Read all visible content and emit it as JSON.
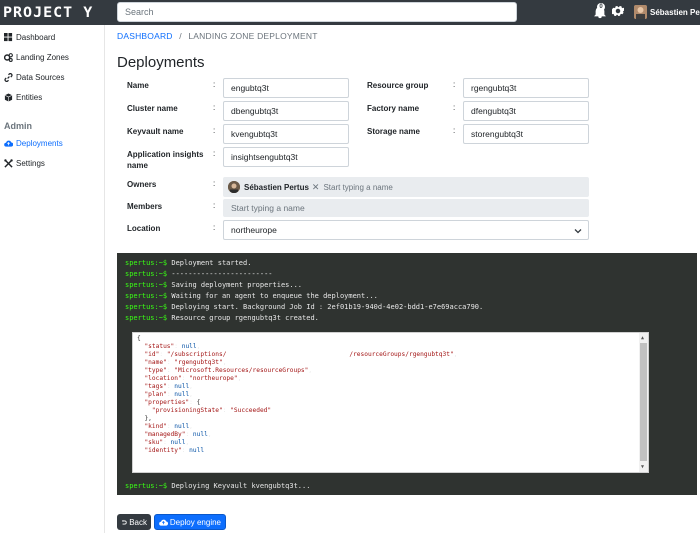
{
  "app": {
    "logo": "PROJECT Y"
  },
  "topbar": {
    "search_placeholder": "Search",
    "notification_count": "0",
    "user_name": "Sébastien Pert"
  },
  "sidebar": {
    "items": [
      {
        "label": "Dashboard",
        "icon": "grid-icon"
      },
      {
        "label": "Landing Zones",
        "icon": "cogs-icon"
      },
      {
        "label": "Data Sources",
        "icon": "link-icon"
      },
      {
        "label": "Entities",
        "icon": "cube-icon"
      }
    ],
    "admin_header": "Admin",
    "admin_items": [
      {
        "label": "Deployments",
        "icon": "cloud-upload-icon",
        "active": true
      },
      {
        "label": "Settings",
        "icon": "tools-icon"
      }
    ]
  },
  "breadcrumb": {
    "home": "DASHBOARD",
    "separator": "/",
    "current": "LANDING ZONE DEPLOYMENT"
  },
  "page_title": "Deployments",
  "form": {
    "name_label": "Name",
    "name_value": "engubtq3t",
    "cluster_label": "Cluster name",
    "cluster_value": "dbengubtq3t",
    "keyvault_label": "Keyvault name",
    "keyvault_value": "kvengubtq3t",
    "insights_label": "Application insights name",
    "insights_value": "insightsengubtq3t",
    "rg_label": "Resource group",
    "rg_value": "rgengubtq3t",
    "factory_label": "Factory name",
    "factory_value": "dfengubtq3t",
    "storage_label": "Storage name",
    "storage_value": "storengubtq3t",
    "owners_label": "Owners",
    "owner_chip": "Sébastien Pertus",
    "owners_placeholder": "Start typing a name",
    "members_label": "Members",
    "members_placeholder": "Start typing a name",
    "location_label": "Location",
    "location_value": "northeurope",
    "colon": ":"
  },
  "console": {
    "prompt": "spertus:~$",
    "lines": [
      "Deployment started.",
      "------------------------",
      "Saving deployment properties...",
      "Waiting for an agent to enqueue the deployment...",
      "Deploying start. Background Job Id : 2ef01b19-940d-4e02-bdd1-e7e69acca790.",
      "Resource group rgengubtq3t created."
    ],
    "last_line": "Deploying Keyvault kvengubtq3t...",
    "json": {
      "open": "{",
      "status_key": "\"status\"",
      "status_val": "null",
      "id_key": "\"id\"",
      "id_val_a": "\"/subscriptions/",
      "id_val_b": "/resourceGroups/rgengubtq3t\"",
      "name_key": "\"name\"",
      "name_val": "\"rgengubtq3t\"",
      "type_key": "\"type\"",
      "type_val": "\"Microsoft.Resources/resourceGroups\"",
      "location_key": "\"location\"",
      "location_val": "\"northeurope\"",
      "tags_key": "\"tags\"",
      "tags_val": "null",
      "plan_key": "\"plan\"",
      "plan_val": "null",
      "properties_key": "\"properties\"",
      "properties_open": "{",
      "ps_key": "\"provisioningState\"",
      "ps_val": "\"Succeeded\"",
      "properties_close": "},",
      "kind_key": "\"kind\"",
      "kind_val": "null",
      "managedby_key": "\"managedBy\"",
      "managedby_val": "null",
      "sku_key": "\"sku\"",
      "sku_val": "null",
      "identity_key": "\"identity\"",
      "identity_val": "null"
    }
  },
  "buttons": {
    "back": "Back",
    "deploy": "Deploy engine"
  },
  "colors": {
    "topbar": "#343a40",
    "accent": "#0d6efd",
    "console_bg": "#2f3330",
    "prompt": "#39ff14"
  }
}
